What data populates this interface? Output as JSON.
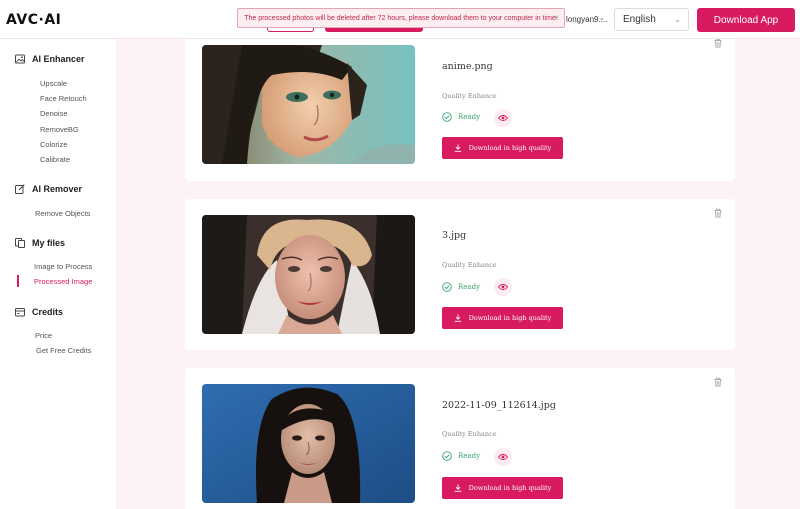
{
  "brand": {
    "logo": "AVC·AI"
  },
  "header": {
    "notice": "The processed photos will be deleted after 72 hours, please download them to your computer in time.",
    "notice_close": "×",
    "user": "longyan9....",
    "language": "English",
    "download_app": "Download App"
  },
  "sidebar": {
    "sections": [
      {
        "title": "AI Enhancer",
        "icon": "image-icon",
        "items": [
          "Upscale",
          "Face Retouch",
          "Denoise",
          "RemoveBG",
          "Colorize",
          "Calibrate"
        ]
      },
      {
        "title": "AI Remover",
        "icon": "edit-icon",
        "items": [
          "Remove Objects"
        ]
      },
      {
        "title": "My files",
        "icon": "files-icon",
        "items": [
          "Image to Process",
          "Processed Image"
        ]
      },
      {
        "title": "Credits",
        "icon": "credits-icon",
        "items": [
          "Price",
          "Get Free Credits"
        ]
      }
    ],
    "active_item": "Processed Image"
  },
  "files": [
    {
      "name": "anime.png",
      "quality_label": "Quality Enhance",
      "status": "Ready",
      "download_label": "Download in high quality"
    },
    {
      "name": "3.jpg",
      "quality_label": "Quality Enhance",
      "status": "Ready",
      "download_label": "Download in high quality"
    },
    {
      "name": "2022-11-09_112614.jpg",
      "quality_label": "Quality Enhance",
      "status": "Ready",
      "download_label": "Download in high quality"
    }
  ],
  "colors": {
    "accent": "#d81b60",
    "ready": "#37a46d",
    "background": "#fdf2f4"
  }
}
